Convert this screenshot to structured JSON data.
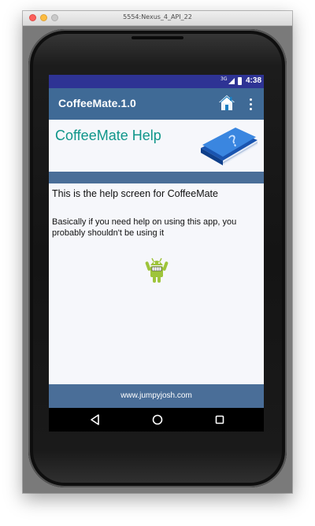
{
  "window": {
    "title": "5554:Nexus_4_API_22"
  },
  "status_bar": {
    "network": "3G",
    "time": "4:38"
  },
  "app_bar": {
    "title": "CoffeeMate.1.0",
    "home_icon": "home-icon",
    "menu_icon": "overflow-menu-icon"
  },
  "help": {
    "title": "CoffeeMate Help",
    "book_icon": "help-book-icon",
    "text1": "This is the help screen for CoffeeMate",
    "text2": "Basically if you need help on using this app, you probably shouldn't be using it",
    "image": "android-mascot-icon"
  },
  "footer": {
    "text": "www.jumpyjosh.com"
  },
  "nav": {
    "back": "back-icon",
    "home": "home-circle-icon",
    "recents": "recents-icon"
  },
  "colors": {
    "status_bar": "#2e3394",
    "app_bar": "#3f6a96",
    "accent_text": "#0f968a",
    "footer": "#4a6e98",
    "screen_bg": "#f6f7fb"
  }
}
